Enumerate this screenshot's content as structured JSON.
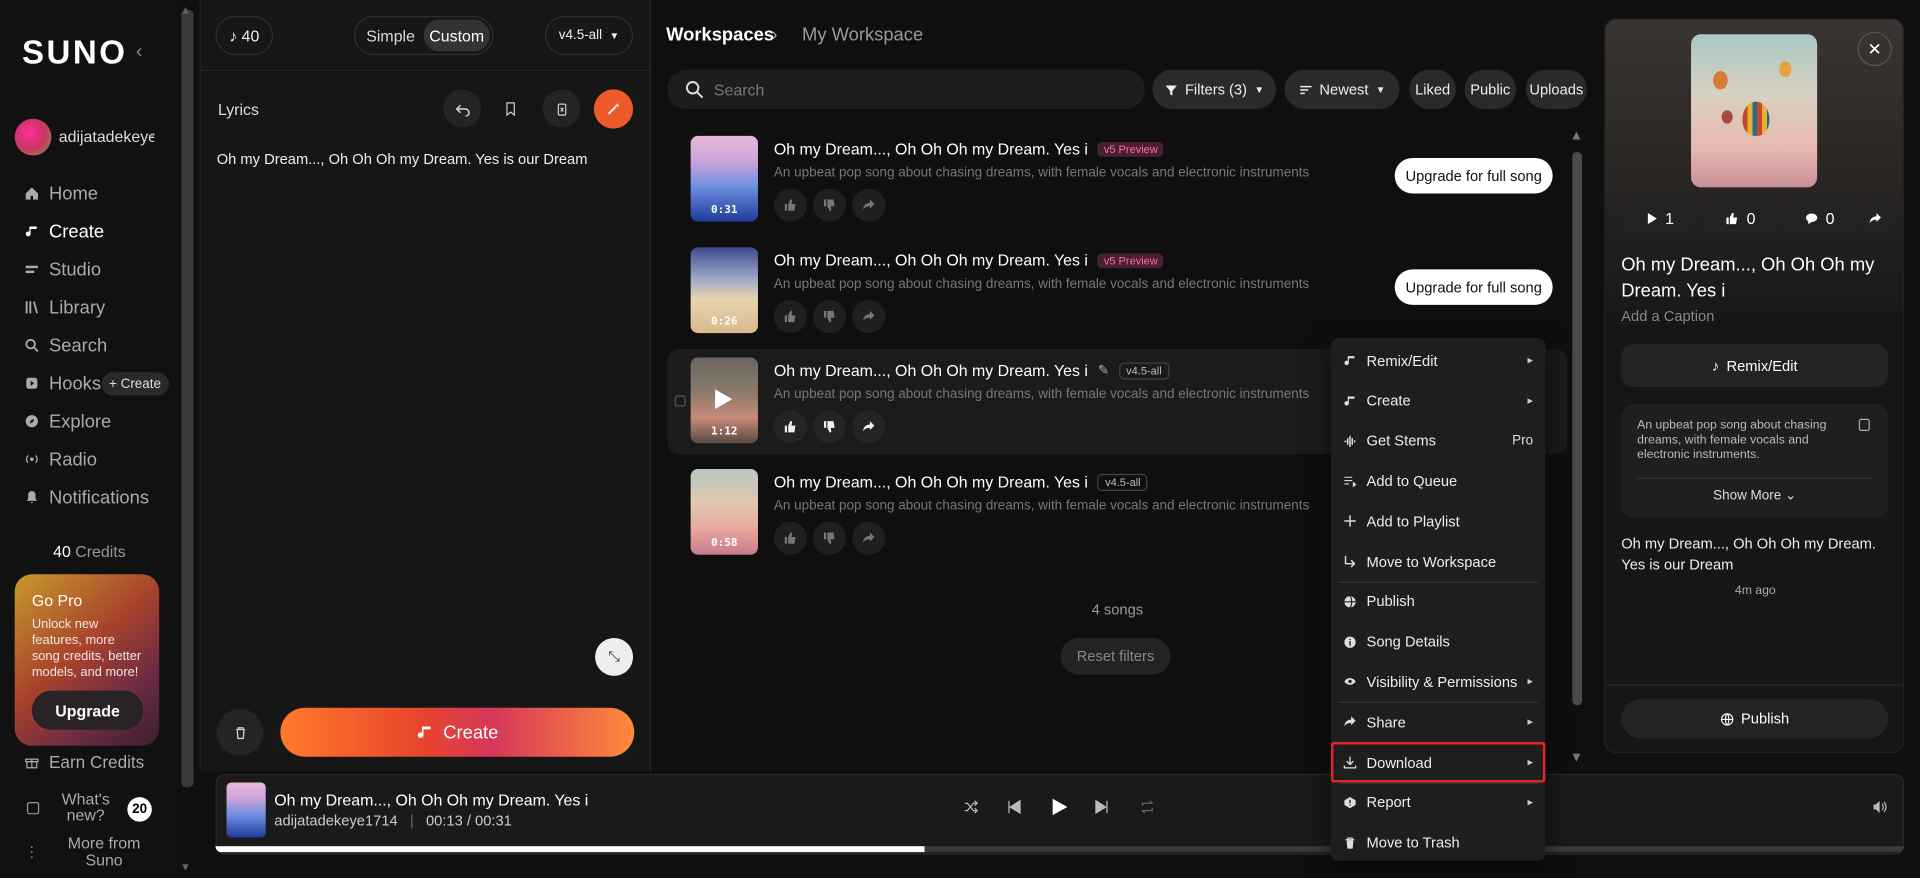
{
  "sidebar": {
    "logo": "SUNO",
    "collapse_icon": "chevron-left-icon",
    "username": "adijatadekeye",
    "nav": [
      {
        "label": "Home",
        "icon": "home-icon"
      },
      {
        "label": "Create",
        "icon": "music-note-icon"
      },
      {
        "label": "Studio",
        "icon": "studio-icon"
      },
      {
        "label": "Library",
        "icon": "library-icon"
      },
      {
        "label": "Search",
        "icon": "search-icon"
      },
      {
        "label": "Hooks",
        "icon": "hooks-icon"
      },
      {
        "label": "Explore",
        "icon": "compass-icon"
      },
      {
        "label": "Radio",
        "icon": "radio-icon"
      },
      {
        "label": "Notifications",
        "icon": "bell-icon"
      }
    ],
    "hooks_create": "+ Create",
    "credits_num": "40",
    "credits_label": "Credits",
    "gopro_title": "Go Pro",
    "gopro_text": "Unlock new features, more song credits, better models, and more!",
    "upgrade": "Upgrade",
    "earn_credits": "Earn Credits",
    "whats_new": "What's new?",
    "whats_new_count": "20",
    "more_from": "More from Suno"
  },
  "create": {
    "credits": "40",
    "mode_simple": "Simple",
    "mode_custom": "Custom",
    "model": "v4.5-all",
    "lyrics_label": "Lyrics",
    "lyrics_text": "Oh my Dream..., Oh Oh Oh my Dream. Yes is our Dream",
    "create_button": "Create"
  },
  "library": {
    "crumb_root": "Workspaces",
    "crumb_current": "My Workspace",
    "search_placeholder": "Search",
    "filters": "Filters (3)",
    "sort": "Newest",
    "liked": "Liked",
    "public": "Public",
    "uploads": "Uploads",
    "songs": [
      {
        "title": "Oh my Dream..., Oh Oh Oh my Dream. Yes i",
        "tag": "v5 Preview",
        "desc": "An upbeat pop song about chasing dreams, with female vocals and electronic instruments",
        "duration": "0:31",
        "cta": "Upgrade for full song"
      },
      {
        "title": "Oh my Dream..., Oh Oh Oh my Dream. Yes i",
        "tag": "v5 Preview",
        "desc": "An upbeat pop song about chasing dreams, with female vocals and electronic instruments",
        "duration": "0:26",
        "cta": "Upgrade for full song"
      },
      {
        "title": "Oh my Dream..., Oh Oh Oh my Dream. Yes i",
        "tag": "v4.5-all",
        "desc": "An upbeat pop song about chasing dreams, with female vocals and electronic instruments",
        "duration": "1:12",
        "cta": ""
      },
      {
        "title": "Oh my Dream..., Oh Oh Oh my Dream. Yes i",
        "tag": "v4.5-all",
        "desc": "An upbeat pop song about chasing dreams, with female vocals and electronic instruments",
        "duration": "0:58",
        "cta": ""
      }
    ],
    "count": "4 songs",
    "reset": "Reset filters"
  },
  "menu": {
    "items": [
      {
        "label": "Remix/Edit",
        "icon": "music-note-icon",
        "arrow": "▸"
      },
      {
        "label": "Create",
        "icon": "music-note-icon",
        "arrow": "▸"
      },
      {
        "label": "Get Stems",
        "icon": "stems-icon",
        "pro": "Pro"
      },
      {
        "label": "Add to Queue",
        "icon": "queue-icon"
      },
      {
        "label": "Add to Playlist",
        "icon": "plus-icon"
      },
      {
        "label": "Move to Workspace",
        "icon": "move-icon"
      },
      {
        "label": "Publish",
        "icon": "globe-icon"
      },
      {
        "label": "Song Details",
        "icon": "info-icon"
      },
      {
        "label": "Visibility & Permissions",
        "icon": "eye-icon",
        "arrow": "▸"
      },
      {
        "label": "Share",
        "icon": "share-icon",
        "arrow": "▸"
      },
      {
        "label": "Download",
        "icon": "download-icon",
        "arrow": "▸"
      },
      {
        "label": "Report",
        "icon": "report-icon",
        "arrow": "▸"
      },
      {
        "label": "Move to Trash",
        "icon": "trash-icon"
      }
    ]
  },
  "detail": {
    "plays": "1",
    "likes": "0",
    "comments": "0",
    "title": "Oh my Dream..., Oh Oh Oh my Dream. Yes i",
    "caption": "Add a Caption",
    "remix": "Remix/Edit",
    "desc": "An upbeat pop song about chasing dreams, with female vocals and electronic instruments.",
    "show_more": "Show More ⌄",
    "lyrics": "Oh my Dream..., Oh Oh Oh my Dream. Yes is our Dream",
    "time_ago": "4m ago",
    "publish": "Publish"
  },
  "player": {
    "title": "Oh my Dream..., Oh Oh Oh my Dream. Yes i",
    "artist": "adijatadekeye1714",
    "sep": "|",
    "current": "00:13",
    "slash": "/",
    "total": "00:31",
    "progress": 0.42
  },
  "colors": {
    "accent": "#ff6a2a",
    "highlight_box": "#e0242a",
    "v5_tag": "#ff6aa6"
  }
}
